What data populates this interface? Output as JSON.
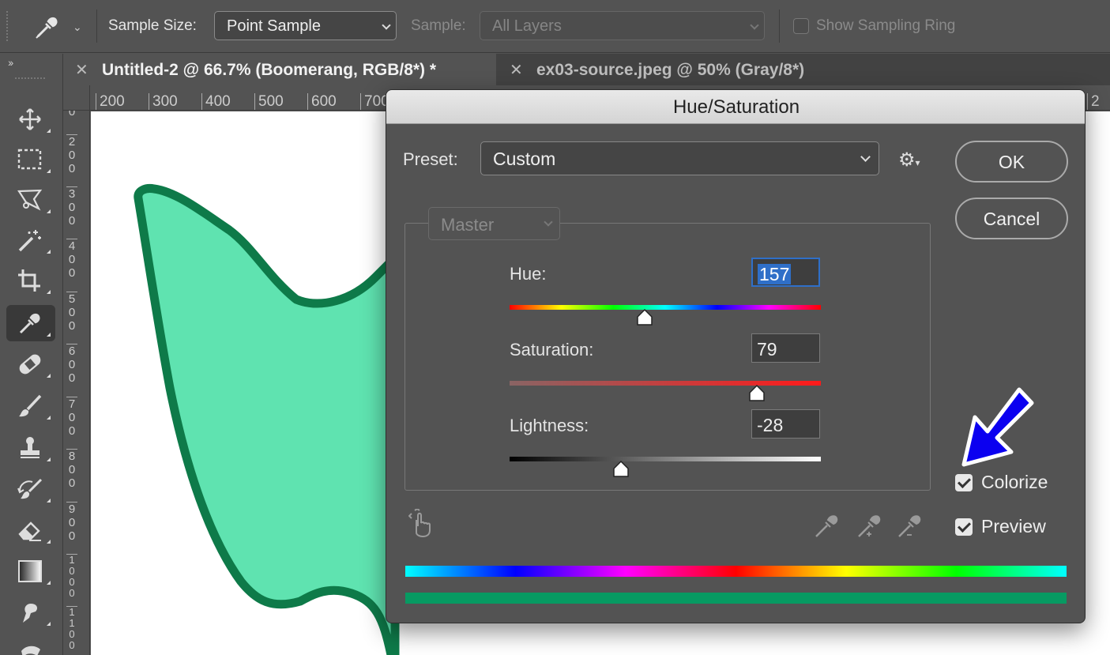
{
  "options_bar": {
    "sample_size_label": "Sample Size:",
    "sample_size_value": "Point Sample",
    "sample_label": "Sample:",
    "sample_value": "All Layers",
    "show_sampling_ring_label": "Show Sampling Ring",
    "show_sampling_ring_checked": false,
    "tool_icon": "eyedropper-icon"
  },
  "toolbar": {
    "collapse_label": "››",
    "tools": [
      {
        "name": "move-tool",
        "icon": "move-icon",
        "active": false
      },
      {
        "name": "marquee-tool",
        "icon": "rectangle-marquee-icon",
        "active": false
      },
      {
        "name": "lasso-tool",
        "icon": "polygon-lasso-icon",
        "active": false
      },
      {
        "name": "magic-wand-tool",
        "icon": "magic-wand-icon",
        "active": false
      },
      {
        "name": "crop-tool",
        "icon": "crop-icon",
        "active": false
      },
      {
        "name": "eyedropper-tool",
        "icon": "eyedropper-icon",
        "active": true
      },
      {
        "name": "healing-brush-tool",
        "icon": "bandage-icon",
        "active": false
      },
      {
        "name": "brush-tool",
        "icon": "brush-icon",
        "active": false
      },
      {
        "name": "stamp-tool",
        "icon": "clone-stamp-icon",
        "active": false
      },
      {
        "name": "history-brush-tool",
        "icon": "history-brush-icon",
        "active": false
      },
      {
        "name": "eraser-tool",
        "icon": "eraser-icon",
        "active": false
      },
      {
        "name": "gradient-tool",
        "icon": "gradient-icon",
        "active": false
      },
      {
        "name": "smudge-tool",
        "icon": "smudge-icon",
        "active": false
      }
    ]
  },
  "tabs": [
    {
      "title": "Untitled-2 @ 66.7% (Boomerang, RGB/8*) *",
      "active": true
    },
    {
      "title": "ex03-source.jpeg @ 50% (Gray/8*)",
      "active": false
    }
  ],
  "ruler": {
    "h_ticks": [
      "200",
      "300",
      "400",
      "500",
      "600",
      "700"
    ],
    "h_tick_right": "2",
    "v_ticks": [
      [
        "0"
      ],
      [
        "2",
        "0",
        "0"
      ],
      [
        "3",
        "0",
        "0"
      ],
      [
        "4",
        "0",
        "0"
      ],
      [
        "5",
        "0",
        "0"
      ],
      [
        "6",
        "0",
        "0"
      ],
      [
        "7",
        "0",
        "0"
      ],
      [
        "8",
        "0",
        "0"
      ],
      [
        "9",
        "0",
        "0"
      ],
      [
        "1",
        "0",
        "0",
        "0"
      ],
      [
        "1",
        "1",
        "0",
        "0"
      ]
    ]
  },
  "canvas": {
    "shape_fill": "#5fe3b0",
    "shape_stroke": "#0e7a49"
  },
  "dialog": {
    "title": "Hue/Saturation",
    "preset_label": "Preset:",
    "preset_value": "Custom",
    "channel_value": "Master",
    "ok_label": "OK",
    "cancel_label": "Cancel",
    "hue_label": "Hue:",
    "hue_value": "157",
    "saturation_label": "Saturation:",
    "saturation_value": "79",
    "lightness_label": "Lightness:",
    "lightness_value": "-28",
    "colorize_label": "Colorize",
    "colorize_checked": true,
    "preview_label": "Preview",
    "preview_checked": true,
    "result_color": "#079a62"
  },
  "annotation": {
    "arrow_color": "#0b00f0",
    "arrow_icon": "blue-arrow-pointer-icon"
  }
}
